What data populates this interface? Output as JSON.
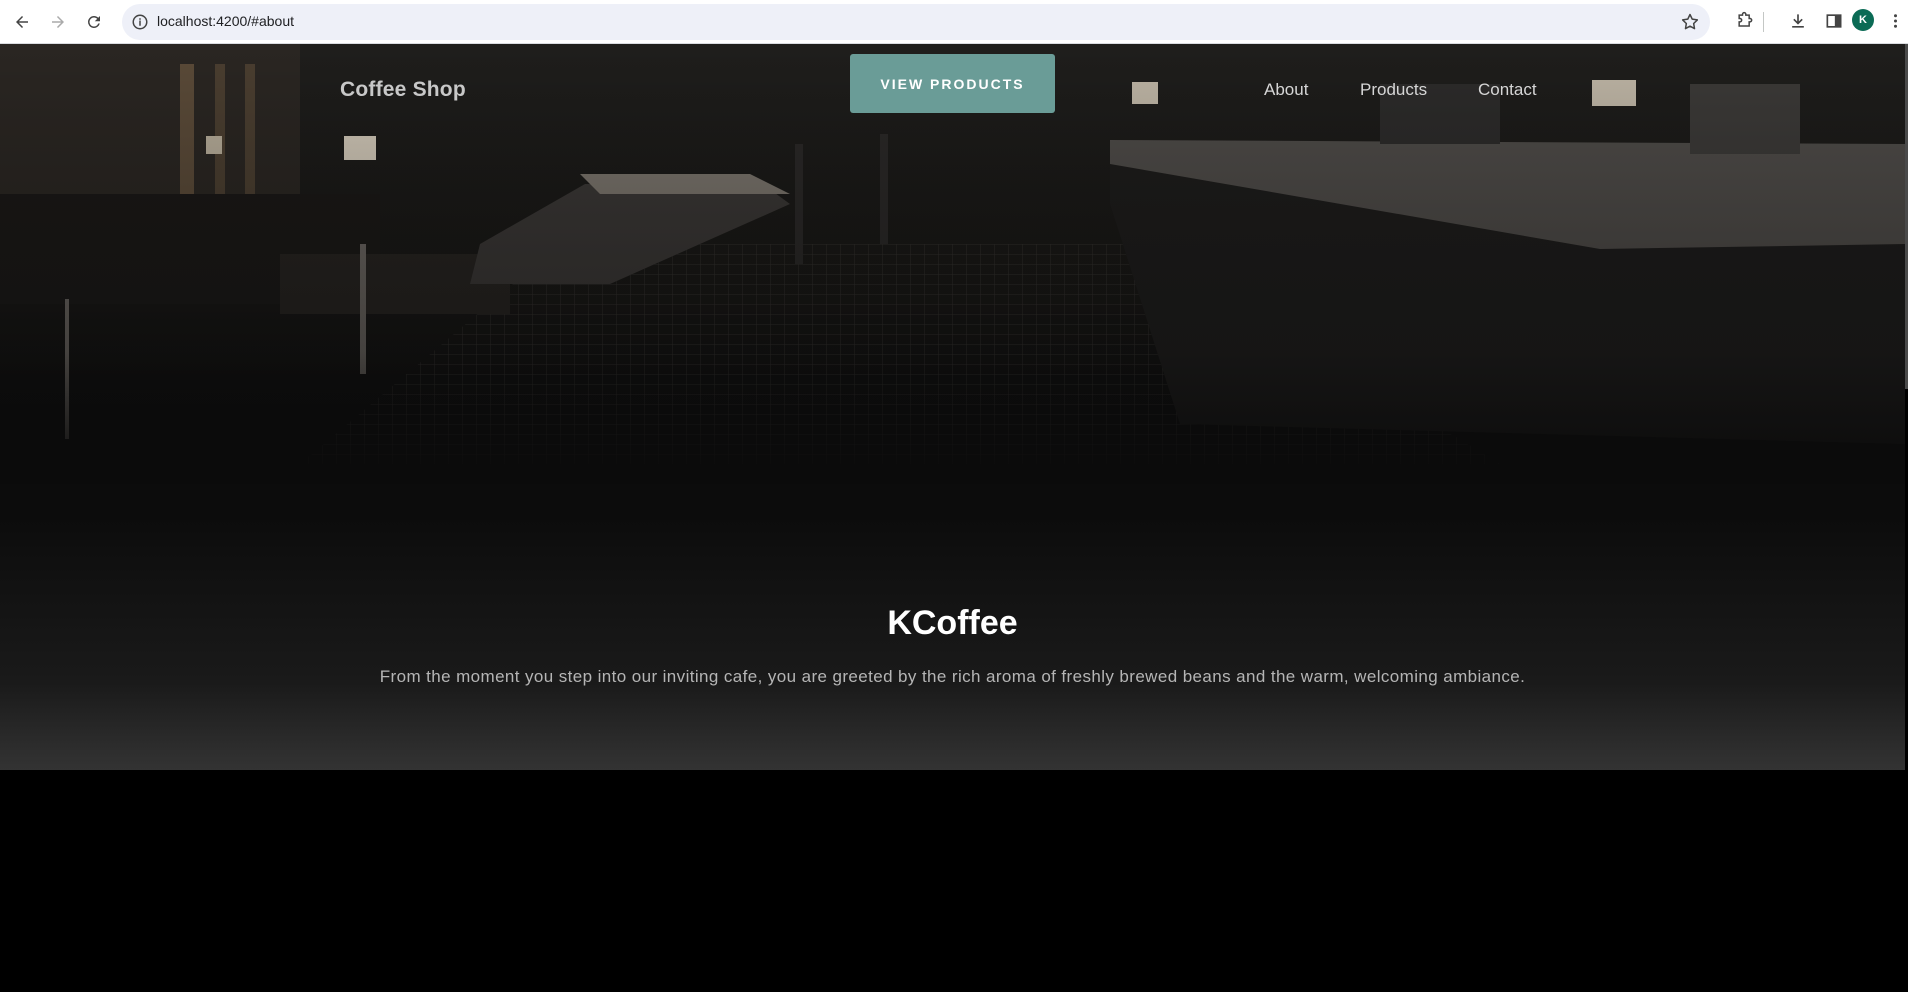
{
  "browser": {
    "url": "localhost:4200/#about",
    "profile_initial": "K",
    "icons": {
      "back": "arrow-left-icon",
      "forward": "arrow-right-icon",
      "reload": "reload-icon",
      "site_info": "info-icon",
      "bookmark": "star-icon",
      "extensions": "puzzle-icon",
      "downloads": "download-icon",
      "side_panel": "side-panel-icon",
      "menu": "kebab-menu-icon"
    }
  },
  "site": {
    "brand": "Coffee Shop",
    "cta_label": "VIEW PRODUCTS",
    "nav": [
      "About",
      "Products",
      "Contact"
    ],
    "hero_title": "KCoffee",
    "hero_text": "From the moment you step into our inviting cafe, you are greeted by the rich aroma of freshly brewed beans and the warm, welcoming ambiance."
  },
  "colors": {
    "cta_background": "#6a9c97",
    "page_background": "#000000",
    "profile_badge": "#0b6b55"
  }
}
